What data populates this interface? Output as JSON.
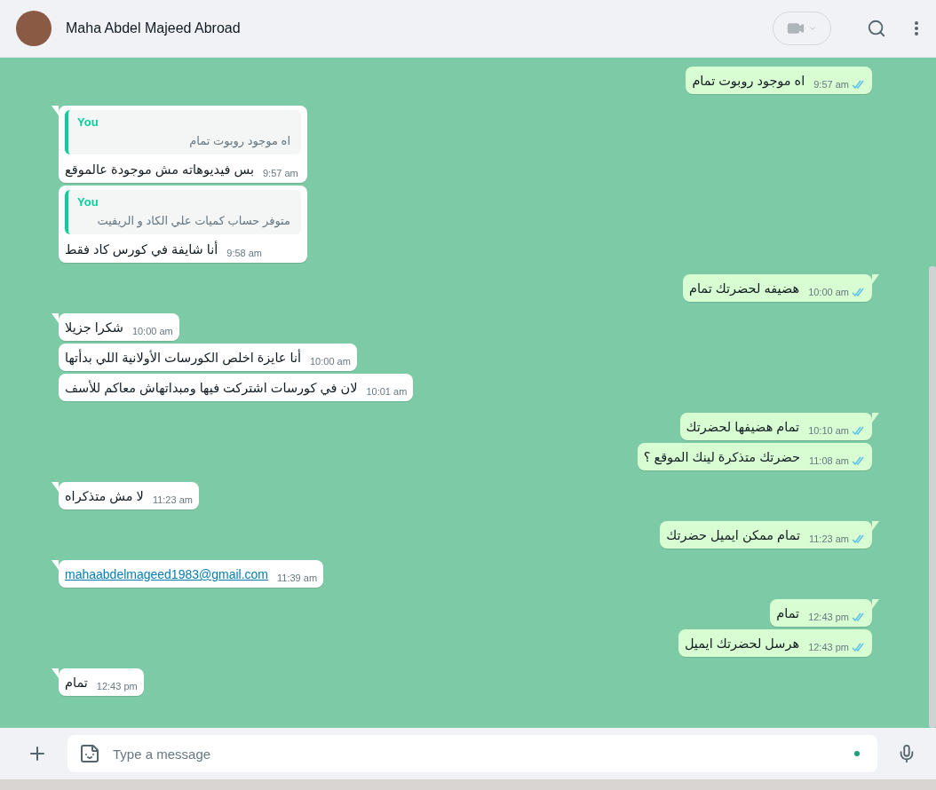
{
  "header": {
    "name": "Maha Abdel Majeed Abroad"
  },
  "messages": [
    {
      "outgoing": true,
      "tail": false,
      "kind": "text",
      "text": "اه موجود روبوت تمام",
      "time": "9:57 am",
      "read": true
    },
    {
      "outgoing": false,
      "tail": true,
      "kind": "text",
      "quote": {
        "author": "You",
        "text": "اه موجود روبوت تمام"
      },
      "text": "بس فيديوهاته مش موجودة عالموقع",
      "time": "9:57 am"
    },
    {
      "outgoing": false,
      "tail": false,
      "kind": "text",
      "quote": {
        "author": "You",
        "text": "متوفر حساب كميات علي الكاد و الريفيت"
      },
      "text": "أنا شايفة في كورس كاد فقط",
      "time": "9:58 am"
    },
    {
      "outgoing": true,
      "tail": true,
      "kind": "text",
      "text": "هضيفه لحضرتك تمام",
      "time": "10:00 am",
      "read": true
    },
    {
      "outgoing": false,
      "tail": true,
      "kind": "text",
      "text": "شكرا جزيلا",
      "time": "10:00 am"
    },
    {
      "outgoing": false,
      "tail": false,
      "kind": "text",
      "text": "أنا عايزة اخلص الكورسات الأولانية اللي بدأتها",
      "time": "10:00 am"
    },
    {
      "outgoing": false,
      "tail": false,
      "kind": "text",
      "text": "لان في كورسات اشتركت فيها ومبداتهاش معاكم للأسف",
      "time": "10:01 am"
    },
    {
      "outgoing": true,
      "tail": true,
      "kind": "text",
      "text": "تمام هضيفها لحضرتك",
      "time": "10:10 am",
      "read": true
    },
    {
      "outgoing": true,
      "tail": false,
      "kind": "text",
      "text": "حضرتك متذكرة لينك الموقع ؟",
      "time": "11:08 am",
      "read": true
    },
    {
      "outgoing": false,
      "tail": true,
      "kind": "text",
      "text": "لا مش متذكراه",
      "time": "11:23 am"
    },
    {
      "outgoing": true,
      "tail": true,
      "kind": "text",
      "text": "تمام ممكن ايميل حضرتك",
      "time": "11:23 am",
      "read": true
    },
    {
      "outgoing": false,
      "tail": true,
      "kind": "link",
      "text": "mahaabdelmageed1983@gmail.com",
      "time": "11:39 am"
    },
    {
      "outgoing": true,
      "tail": true,
      "kind": "text",
      "text": "تمام",
      "time": "12:43 pm",
      "read": true
    },
    {
      "outgoing": true,
      "tail": false,
      "kind": "text",
      "text": "هرسل لحضرتك ايميل",
      "time": "12:43 pm",
      "read": true
    },
    {
      "outgoing": false,
      "tail": true,
      "kind": "text",
      "text": "تمام",
      "time": "12:43 pm"
    }
  ],
  "composer": {
    "placeholder": "Type a message"
  }
}
